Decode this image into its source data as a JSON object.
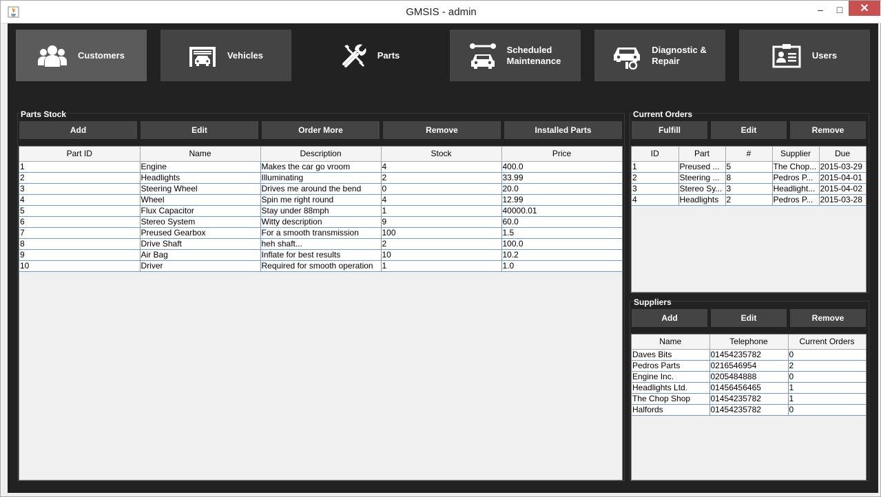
{
  "window": {
    "title": "GMSIS - admin",
    "min": "–",
    "max": "□",
    "close": "✕"
  },
  "nav": [
    {
      "label": "Customers",
      "icon": "customers-icon"
    },
    {
      "label": "Vehicles",
      "icon": "garage-car-icon"
    },
    {
      "label": "Parts",
      "icon": "wrench-screwdriver-icon"
    },
    {
      "label": "Scheduled\nMaintenance",
      "icon": "car-wrench-icon"
    },
    {
      "label": "Diagnostic &\nRepair",
      "icon": "car-lift-icon"
    },
    {
      "label": "Users",
      "icon": "id-card-icon"
    }
  ],
  "parts_stock": {
    "title": "Parts Stock",
    "buttons": [
      "Add",
      "Edit",
      "Order More",
      "Remove",
      "Installed Parts"
    ],
    "columns": [
      "Part ID",
      "Name",
      "Description",
      "Stock",
      "Price"
    ],
    "rows": [
      [
        "1",
        "Engine",
        "Makes the car go vroom",
        "4",
        "400.0"
      ],
      [
        "2",
        "Headlights",
        "Illuminating",
        "2",
        "33.99"
      ],
      [
        "3",
        "Steering Wheel",
        "Drives me around the bend",
        "0",
        "20.0"
      ],
      [
        "4",
        "Wheel",
        "Spin me right round",
        "4",
        "12.99"
      ],
      [
        "5",
        "Flux Capacitor",
        "Stay under 88mph",
        "1",
        "40000.01"
      ],
      [
        "6",
        "Stereo System",
        "Witty description",
        "9",
        "60.0"
      ],
      [
        "7",
        "Preused Gearbox",
        "For a smooth transmission",
        "100",
        "1.5"
      ],
      [
        "8",
        "Drive Shaft",
        "heh shaft...",
        "2",
        "100.0"
      ],
      [
        "9",
        "Air Bag",
        "Inflate for best results",
        "10",
        "10.2"
      ],
      [
        "10",
        "Driver",
        "Required for smooth operation",
        "1",
        "1.0"
      ]
    ]
  },
  "current_orders": {
    "title": "Current Orders",
    "buttons": [
      "Fulfill",
      "Edit",
      "Remove"
    ],
    "columns": [
      "ID",
      "Part",
      "#",
      "Supplier",
      "Due"
    ],
    "rows": [
      [
        "1",
        "Preused ...",
        "5",
        "The Chop...",
        "2015-03-29"
      ],
      [
        "2",
        "Steering ...",
        "8",
        "Pedros P...",
        "2015-04-01"
      ],
      [
        "3",
        "Stereo Sy...",
        "3",
        "Headlight...",
        "2015-04-02"
      ],
      [
        "4",
        "Headlights",
        "2",
        "Pedros P...",
        "2015-03-28"
      ]
    ]
  },
  "suppliers": {
    "title": "Suppliers",
    "buttons": [
      "Add",
      "Edit",
      "Remove"
    ],
    "columns": [
      "Name",
      "Telephone",
      "Current Orders"
    ],
    "rows": [
      [
        "Daves Bits",
        "01454235782",
        "0"
      ],
      [
        "Pedros Parts",
        "0216546954",
        "2"
      ],
      [
        "Engine Inc.",
        "0205484888",
        "0"
      ],
      [
        "Headlights Ltd.",
        "01456456465",
        "1"
      ],
      [
        "The Chop Shop",
        "01454235782",
        "1"
      ],
      [
        "Halfords",
        "01454235782",
        "0"
      ]
    ]
  }
}
